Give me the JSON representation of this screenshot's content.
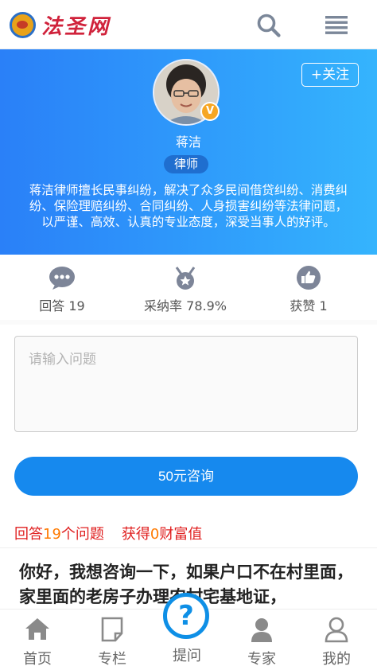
{
  "header": {
    "logo_text": "法圣网"
  },
  "lawyer": {
    "follow_label": "+关注",
    "badge_letter": "V",
    "name": "蒋洁",
    "title": "律师",
    "intro": "蒋洁律师擅长民事纠纷，解决了众多民间借贷纠纷、消费纠纷、保险理赔纠纷、合同纠纷、人身损害纠纷等法律问题，以严谨、高效、认真的专业态度，深受当事人的好评。"
  },
  "stats": [
    {
      "label": "回答",
      "value": "19",
      "icon": "chat-bubble-icon"
    },
    {
      "label": "采纳率",
      "value": "78.9%",
      "icon": "medal-icon"
    },
    {
      "label": "获赞",
      "value": "1",
      "icon": "thumbs-up-icon"
    }
  ],
  "question_input": {
    "placeholder": "请输入问题",
    "value": ""
  },
  "consult_button": "50元咨询",
  "summary": {
    "answers_prefix": "回答",
    "answers_count": "19",
    "answers_suffix": "个问题",
    "wealth_prefix": "获得",
    "wealth_count": "0",
    "wealth_suffix": "财富值"
  },
  "latest_question": "你好，我想咨询一下，如果户口不在村里面，家里面的老房子办理农村宅基地证，",
  "bottom_nav": [
    {
      "label": "首页",
      "icon": "home-icon"
    },
    {
      "label": "专栏",
      "icon": "column-page-icon"
    },
    {
      "label": "提问",
      "icon": "question-mark-icon"
    },
    {
      "label": "专家",
      "icon": "expert-person-icon"
    },
    {
      "label": "我的",
      "icon": "user-profile-icon"
    }
  ],
  "colors": {
    "brand_blue": "#1689ee",
    "banner_start": "#2a80f8",
    "banner_end": "#35b4fd",
    "accent_red": "#e02020",
    "accent_orange": "#ff7a00"
  }
}
